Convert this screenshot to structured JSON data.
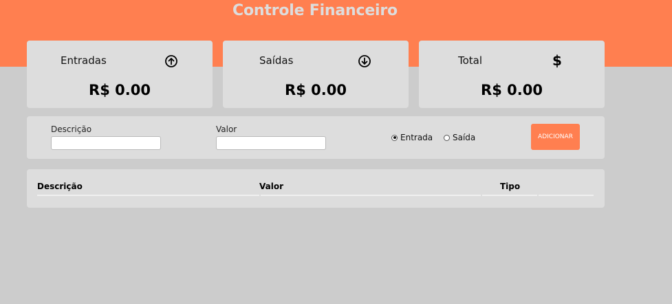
{
  "header": {
    "title": "Controle Financeiro",
    "background": "#ff7f50"
  },
  "cards": [
    {
      "label": "Entradas",
      "icon": "arrow-up-circle-icon",
      "value": "R$ 0.00"
    },
    {
      "label": "Saídas",
      "icon": "arrow-down-circle-icon",
      "value": "R$ 0.00"
    },
    {
      "label": "Total",
      "icon": "dollar-icon",
      "value": "R$ 0.00"
    }
  ],
  "form": {
    "description_label": "Descrição",
    "description_value": "",
    "value_label": "Valor",
    "value_value": "",
    "radio_entrada": "Entrada",
    "radio_saida": "Saída",
    "selected_type": "Entrada",
    "add_button": "ADICIONAR"
  },
  "table": {
    "columns": [
      "Descrição",
      "Valor",
      "Tipo"
    ],
    "rows": []
  },
  "colors": {
    "accent": "#ff7f50",
    "background": "#cccccc",
    "card": "#dddddd"
  }
}
